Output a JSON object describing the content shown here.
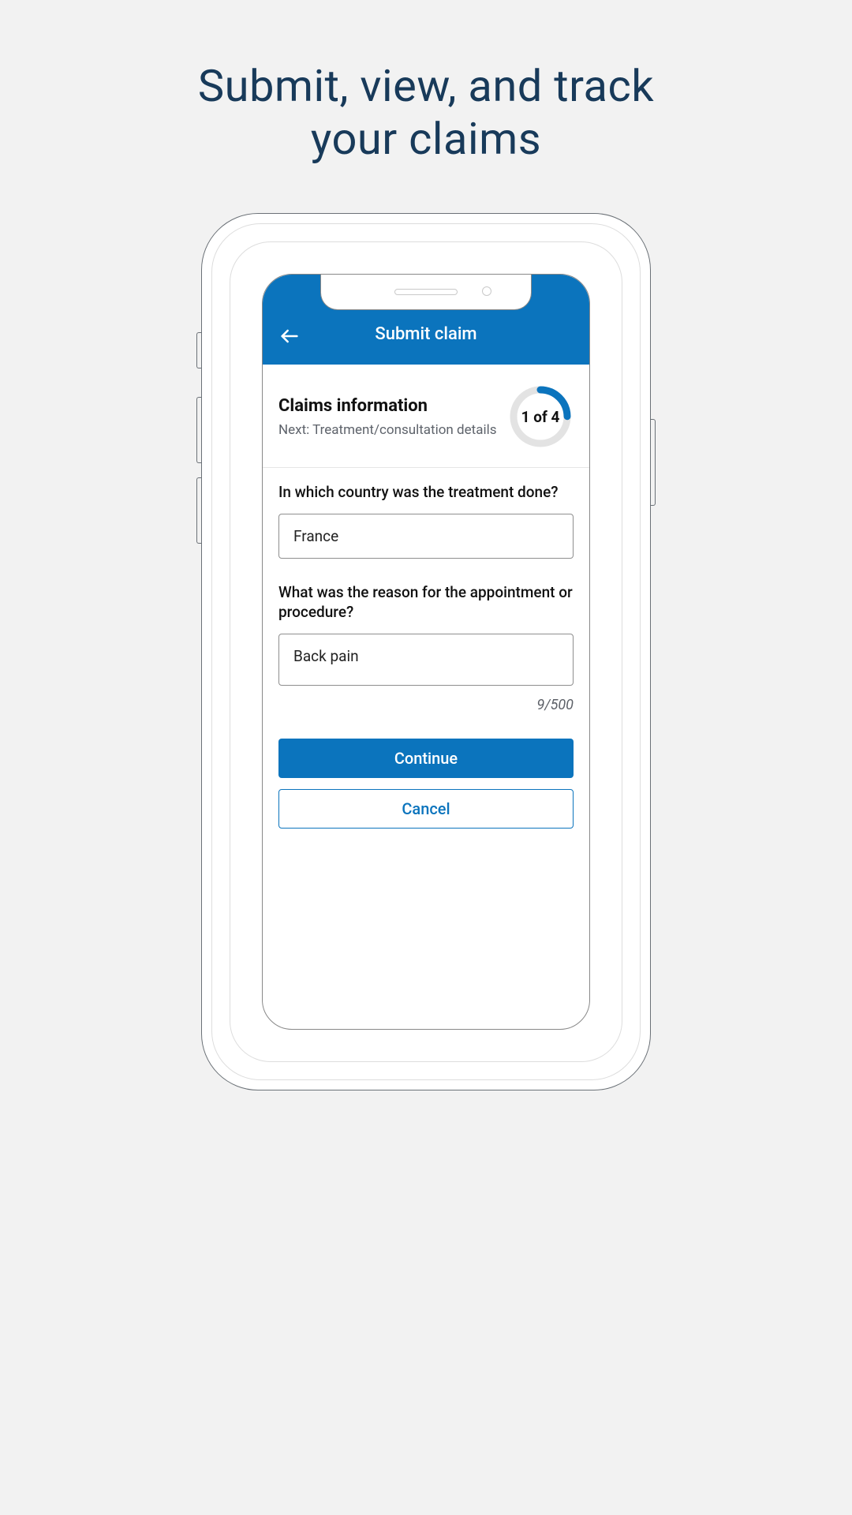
{
  "hero": {
    "line1": "Submit, view, and track",
    "line2": "your claims"
  },
  "header": {
    "title": "Submit claim"
  },
  "progress": {
    "title": "Claims information",
    "next_label": "Next: Treatment/consultation details",
    "step_label": "1 of 4",
    "current": 1,
    "total": 4
  },
  "form": {
    "country_question": "In which country was the treatment done?",
    "country_value": "France",
    "reason_question": "What was the reason for the appointment or procedure?",
    "reason_value": "Back pain",
    "char_counter": "9/500"
  },
  "buttons": {
    "continue": "Continue",
    "cancel": "Cancel"
  }
}
